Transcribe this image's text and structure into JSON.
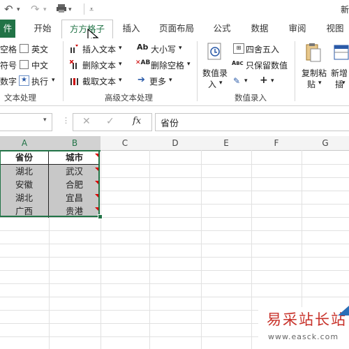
{
  "quick_access": {
    "title_fragment": "新"
  },
  "tabs": [
    {
      "label": "件"
    },
    {
      "label": "开始"
    },
    {
      "label": "方方格子"
    },
    {
      "label": "插入"
    },
    {
      "label": "页面布局"
    },
    {
      "label": "公式"
    },
    {
      "label": "数据"
    },
    {
      "label": "审阅"
    },
    {
      "label": "视图"
    }
  ],
  "ribbon": {
    "text_group": {
      "items": [
        "空格",
        "英文",
        "符号",
        "中文",
        "数字",
        "执行"
      ],
      "label": "文本处理"
    },
    "advanced_group": {
      "items": [
        "插入文本",
        "删除文本",
        "截取文本",
        "大小写",
        "删除空格",
        "更多"
      ],
      "label": "高级文本处理"
    },
    "numeric_group": {
      "big_button_line1": "数值录",
      "big_button_line2": "入",
      "items": [
        "四舍五入",
        "只保留数值"
      ],
      "label": "数值录入"
    },
    "copy_group": {
      "copy_line1": "复制粘",
      "copy_line2": "贴",
      "new_line1": "新增",
      "new_line2": "插"
    }
  },
  "formula_bar": {
    "fx": "fx",
    "content": "省份"
  },
  "grid": {
    "columns": [
      "A",
      "B",
      "C",
      "D",
      "E",
      "F",
      "G"
    ],
    "rows": [
      [
        "省份",
        "城市"
      ],
      [
        "湖北",
        "武汉"
      ],
      [
        "安徽",
        "合肥"
      ],
      [
        "湖北",
        "宜昌"
      ],
      [
        "广西",
        "贵港"
      ]
    ]
  },
  "watermark": {
    "text": "易采站长站",
    "url": "www.easck.com"
  },
  "colors": {
    "excel_green": "#217346",
    "selection_fill": "#c8c8c8",
    "header_selected": "#d2d2d2"
  }
}
